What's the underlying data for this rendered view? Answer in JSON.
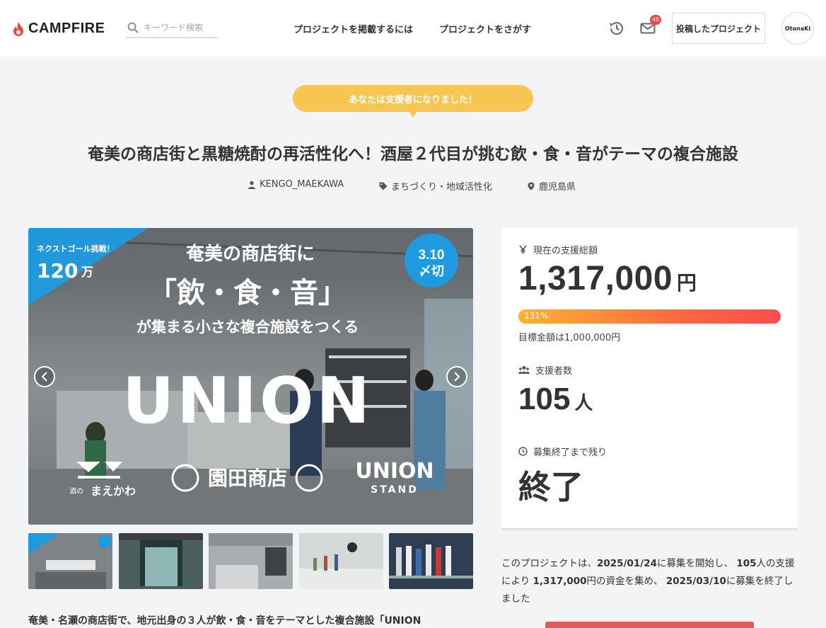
{
  "header": {
    "logo_text": "CAMPFIRE",
    "search_placeholder": "キーワード検索",
    "nav": [
      "プロジェクトを掲載するには",
      "プロジェクトをさがす"
    ],
    "mail_badge": "40",
    "posted_label": "投稿したプロジェクト",
    "avatar_text": "OtonaKi"
  },
  "banner": {
    "supporter_msg": "あなたは支援者になりました！"
  },
  "project": {
    "title": "奄美の商店街と黒糖焼酎の再活性化へ！酒屋２代目が挑む飲・食・音がテーマの複合施設",
    "owner": "KENGO_MAEKAWA",
    "category": "まちづくり・地域活性化",
    "location": "鹿児島県"
  },
  "hero": {
    "next_goal_label": "ネクストゴール挑戦！",
    "next_goal_value": "120",
    "next_goal_unit": "万",
    "deadline_date": "3.10",
    "deadline_label": "〆切",
    "line1": "奄美の商店街に",
    "line2": "「飲・食・音」",
    "line3": "が集まる小さな複合施設をつくる",
    "big_text": "UNION",
    "shop_name": "園田商店",
    "stand_title": "UNION",
    "stand_sub": "STAND",
    "maekawa_small": "酒の",
    "maekawa": "まえかわ"
  },
  "stats": {
    "total_label": "現在の支援総額",
    "total_amount": "1,317,000",
    "total_unit": "円",
    "progress_percent": 131,
    "progress_label": "131%",
    "goal_text": "目標金額は1,000,000円",
    "supporters_label": "支援者数",
    "supporters_count": "105",
    "supporters_unit": "人",
    "remaining_label": "募集終了まで残り",
    "remaining_value": "終了"
  },
  "summary": {
    "p1": "このプロジェクトは、",
    "start_date": "2025/01/24",
    "p2": "に募集を開始し、",
    "count": "105",
    "p3": "人の支援により",
    "amount": "1,317,000",
    "p4": "円の資金を集め、",
    "end_date": "2025/03/10",
    "p5": "に募集を終了しました"
  },
  "description_start": "奄美・名瀬の商店街で、地元出身の３人が飲・食・音をテーマとした複合施設「UNION",
  "colors": {
    "accent": "#f7c552",
    "progress_start": "#f9b233",
    "progress_end": "#fb4c4c",
    "hero_blue": "#1e9be0"
  }
}
